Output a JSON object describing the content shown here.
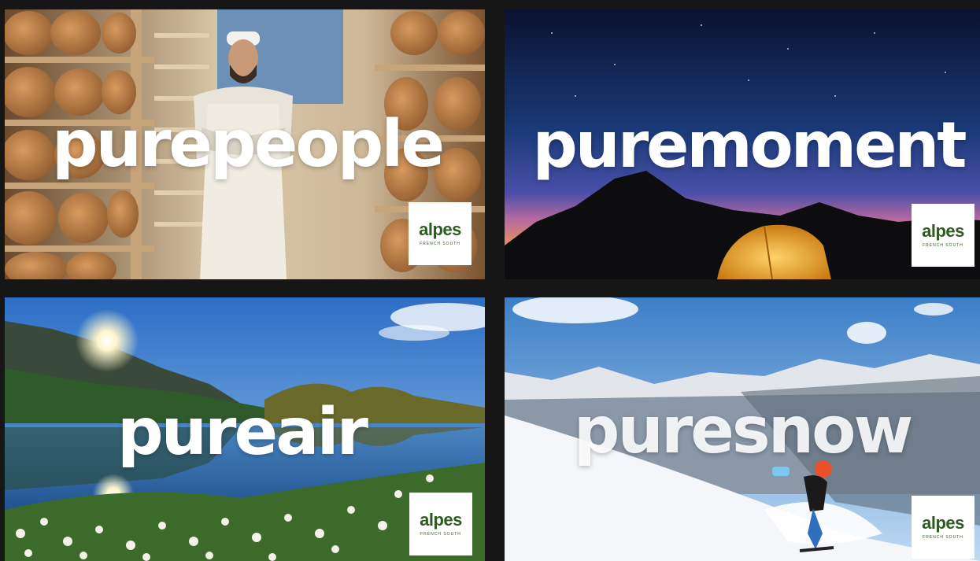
{
  "panels": [
    {
      "headline": "purepeople",
      "logo_word": "alpes",
      "logo_tagline": "FRENCH SOUTH"
    },
    {
      "headline": "puremoment",
      "logo_word": "alpes",
      "logo_tagline": "FRENCH SOUTH"
    },
    {
      "headline": "pureair",
      "logo_word": "alpes",
      "logo_tagline": "FRENCH SOUTH"
    },
    {
      "headline": "puresnow",
      "logo_word": "alpes",
      "logo_tagline": "FRENCH SOUTH"
    }
  ],
  "colors": {
    "background": "#161616",
    "headline": "#ffffff",
    "logo_green": "#2e5b22",
    "logo_box": "#ffffff"
  }
}
